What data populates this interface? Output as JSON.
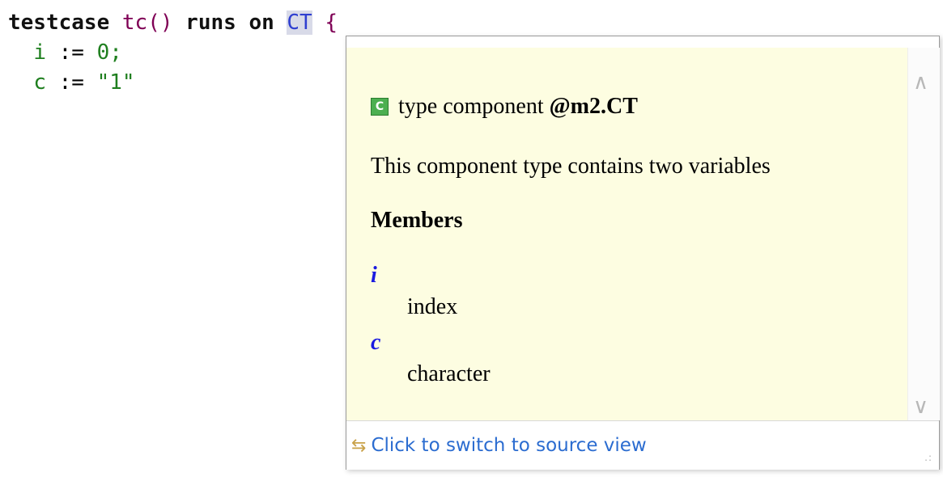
{
  "code": {
    "line1": {
      "kw1": "testcase",
      "fn": "tc()",
      "kw2": "runs on",
      "type_ref": "CT",
      "brace": "{"
    },
    "line2": {
      "var": "i",
      "op": " := ",
      "val": "0;"
    },
    "line3": {
      "var": "c",
      "op": " := ",
      "val": "\"1\""
    }
  },
  "hover": {
    "icon_label": "C",
    "title_prefix": "type component",
    "title_name": "@m2.CT",
    "description": "This component type contains two variables",
    "members_heading": "Members",
    "members": [
      {
        "name": "i",
        "desc": "index"
      },
      {
        "name": "c",
        "desc": "character"
      }
    ],
    "footer_link": "Click to switch to source view",
    "icons": {
      "type": "component-c-icon",
      "switch": "switch-view-icon"
    },
    "colors": {
      "doc_background": "#fdfde1",
      "link": "#2b6cd0",
      "member_name": "#1a1ae0"
    }
  }
}
